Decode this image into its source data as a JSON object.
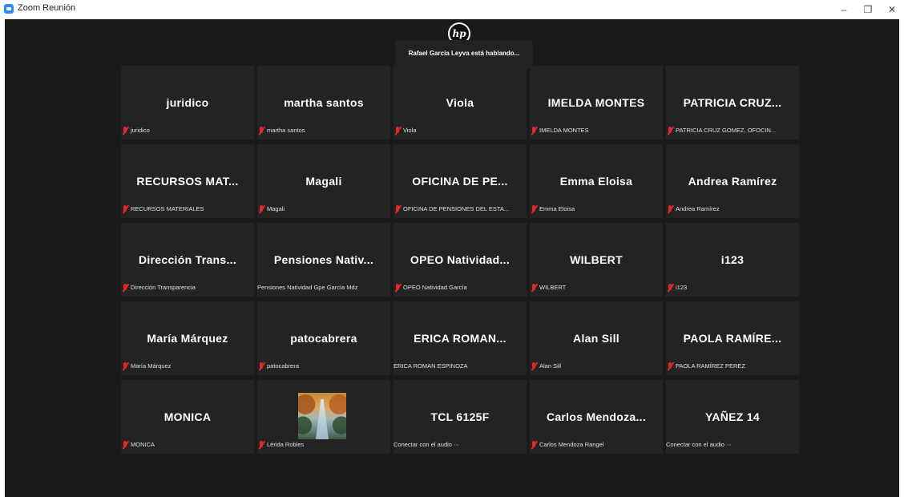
{
  "window": {
    "title": "Zoom Reunión",
    "controls": {
      "minimize": "–",
      "maximize": "❐",
      "close": "✕"
    }
  },
  "meeting": {
    "logo_text": "hp",
    "speaking_banner": "Rafael García Leyva está hablando..."
  },
  "participants": [
    {
      "name": "juridico",
      "label": "juridico",
      "muted": true
    },
    {
      "name": "martha santos",
      "label": "martha santos",
      "muted": true
    },
    {
      "name": "Viola",
      "label": "Viola",
      "muted": true
    },
    {
      "name": "IMELDA MONTES",
      "label": "IMELDA MONTES",
      "muted": true
    },
    {
      "name": "PATRICIA CRUZ...",
      "label": "PATRICIA CRUZ GOMEZ, OFOCIN...",
      "muted": true
    },
    {
      "name": "RECURSOS MAT...",
      "label": "RECURSOS MATERIALES",
      "muted": true
    },
    {
      "name": "Magali",
      "label": "Magali",
      "muted": true
    },
    {
      "name": "OFICINA DE PE...",
      "label": "OFICINA DE PENSIONES DEL ESTA...",
      "muted": true
    },
    {
      "name": "Emma Eloisa",
      "label": "Emma Eloisa",
      "muted": true
    },
    {
      "name": "Andrea Ramírez",
      "label": "Andrea Ramírez",
      "muted": true
    },
    {
      "name": "Dirección Trans...",
      "label": "Dirección Transparencia",
      "muted": true
    },
    {
      "name": "Pensiones Nativ...",
      "label": "Pensiones Natividad Gpe García Mdz",
      "muted": false
    },
    {
      "name": "OPEO Natividad...",
      "label": "OPEO Natividad García",
      "muted": true
    },
    {
      "name": "WILBERT",
      "label": "WILBERT",
      "muted": true
    },
    {
      "name": "i123",
      "label": "i123",
      "muted": true
    },
    {
      "name": "María Márquez",
      "label": "María Márquez",
      "muted": true
    },
    {
      "name": "patocabrera",
      "label": "patocabrera",
      "muted": true
    },
    {
      "name": "ERICA ROMAN...",
      "label": "ERICA ROMAN ESPINOZA",
      "muted": false
    },
    {
      "name": "Alan Sill",
      "label": "Alan Sill",
      "muted": true
    },
    {
      "name": "PAOLA RAMÍRE...",
      "label": "PAOLA RAMÍREZ PEREZ",
      "muted": true
    },
    {
      "name": "MONICA",
      "label": "MONICA",
      "muted": true
    },
    {
      "name": "",
      "label": "Lérida Robles",
      "muted": true,
      "photo": true
    },
    {
      "name": "TCL 6125F",
      "label": "Conectar con el audio",
      "muted": false,
      "audio_icon": true
    },
    {
      "name": "Carlos Mendoza...",
      "label": "Carlos Mendoza Rangel",
      "muted": true
    },
    {
      "name": "YAÑEZ 14",
      "label": "Conectar con el audio",
      "muted": false,
      "audio_icon": true
    }
  ]
}
